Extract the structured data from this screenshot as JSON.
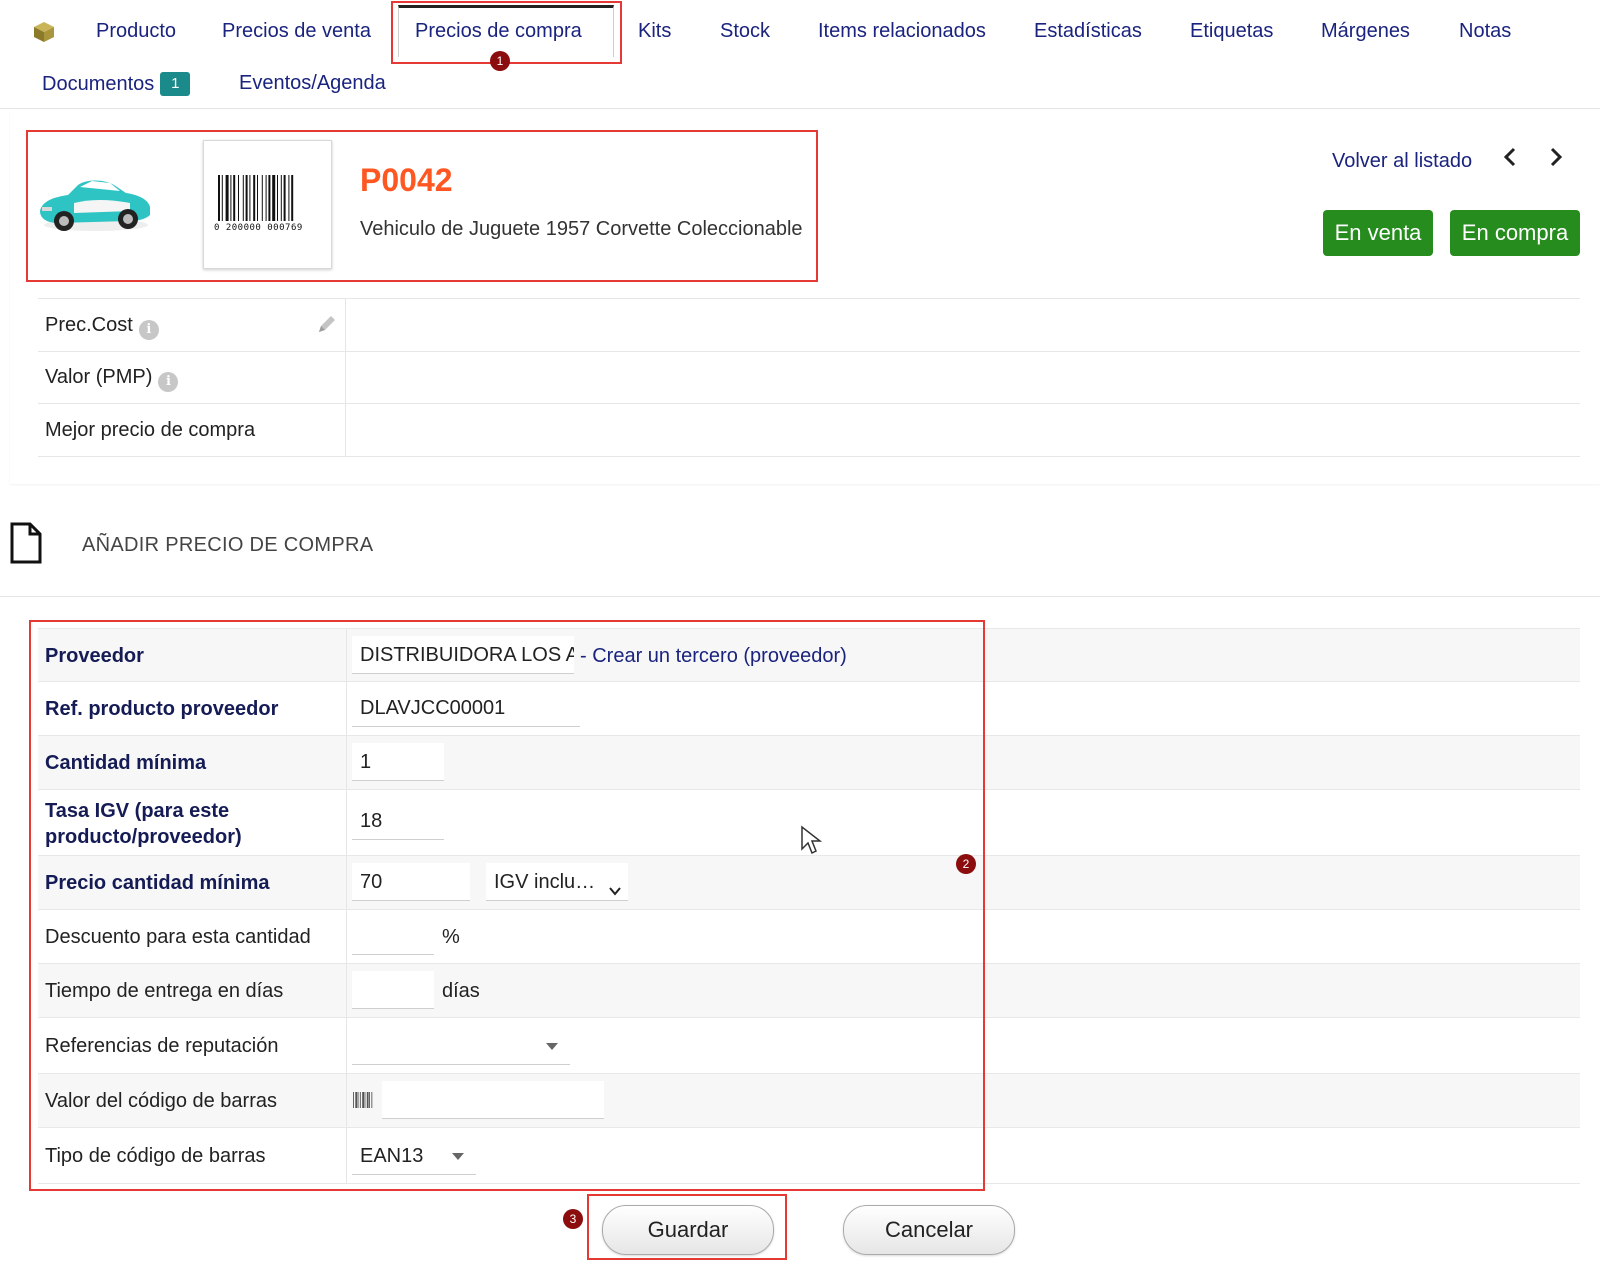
{
  "tabs": {
    "producto": "Producto",
    "precios_venta": "Precios de venta",
    "precios_compra": "Precios de compra",
    "kits": "Kits",
    "stock": "Stock",
    "items": "Items relacionados",
    "estadisticas": "Estadísticas",
    "etiquetas": "Etiquetas",
    "margenes": "Márgenes",
    "notas": "Notas",
    "documentos": "Documentos",
    "documentos_count": "1",
    "eventos": "Eventos/Agenda"
  },
  "markers": [
    "1",
    "2",
    "3"
  ],
  "product": {
    "ref": "P0042",
    "label": "Vehiculo de Juguete 1957 Corvette Coleccionable",
    "barcode_text": "0 200000 000769",
    "back_link": "Volver al listado",
    "prev": "‹",
    "next": "›",
    "status_sell": "En venta",
    "status_buy": "En compra"
  },
  "info": {
    "cost_price": "Prec.Cost",
    "pmp": "Valor (PMP)",
    "best_price": "Mejor precio de compra",
    "info_icon": "i"
  },
  "section": {
    "title": "AÑADIR PRECIO DE COMPRA"
  },
  "form": {
    "supplier_label": "Proveedor",
    "supplier_value": "DISTRIBUIDORA LOS A",
    "create_supplier": "- Crear un tercero (proveedor)",
    "ref_label": "Ref. producto proveedor",
    "ref_value": "DLAVJCC00001",
    "qty_label": "Cantidad mínima",
    "qty_value": "1",
    "vat_label_1": "Tasa IGV (para este",
    "vat_label_2": "producto/proveedor)",
    "vat_value": "18",
    "price_label": "Precio cantidad mínima",
    "price_value": "70",
    "price_base": "IGV inclu…",
    "discount_label": "Descuento para esta cantidad",
    "discount_value": "",
    "discount_unit": "%",
    "delivery_label": "Tiempo de entrega en días",
    "delivery_value": "",
    "delivery_unit": "días",
    "reputation_label": "Referencias de reputación",
    "reputation_value": "",
    "barcode_label": "Valor del código de barras",
    "barcode_value": "",
    "barcode_type_label": "Tipo de código de barras",
    "barcode_type_value": "EAN13"
  },
  "buttons": {
    "save": "Guardar",
    "cancel": "Cancelar"
  },
  "colors": {
    "ref": "#ff5722",
    "status_green": "#258c1d",
    "link": "#1a237e",
    "highlight": "#e53935",
    "marker": "#8b0d0d"
  }
}
